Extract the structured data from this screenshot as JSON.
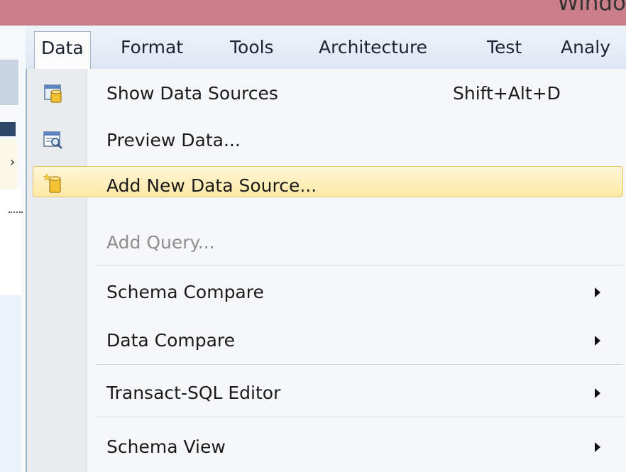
{
  "window": {
    "title_fragment": "Windo"
  },
  "menubar": {
    "items": [
      {
        "label": "Data",
        "active": true
      },
      {
        "label": "Format"
      },
      {
        "label": "Tools"
      },
      {
        "label": "Architecture"
      },
      {
        "label": "Test"
      },
      {
        "label": "Analy"
      }
    ]
  },
  "dropdown": {
    "items": [
      {
        "label": "Show Data Sources",
        "shortcut": "Shift+Alt+D",
        "icon": "data-sources-icon"
      },
      {
        "label": "Preview Data...",
        "icon": "preview-data-icon"
      },
      {
        "label": "Add New Data Source...",
        "icon": "add-data-source-icon",
        "highlighted": true
      },
      {
        "label": "Add Query...",
        "disabled": true
      },
      {
        "label": "Schema Compare",
        "submenu": true
      },
      {
        "label": "Data Compare",
        "submenu": true
      },
      {
        "label": "Transact-SQL Editor",
        "submenu": true
      },
      {
        "label": "Schema View",
        "submenu": true
      }
    ]
  },
  "colors": {
    "title_bar": "#c97e89",
    "highlight": "#fde8a6",
    "highlight_border": "#e6c46a",
    "disabled_text": "#8d8d8d"
  }
}
